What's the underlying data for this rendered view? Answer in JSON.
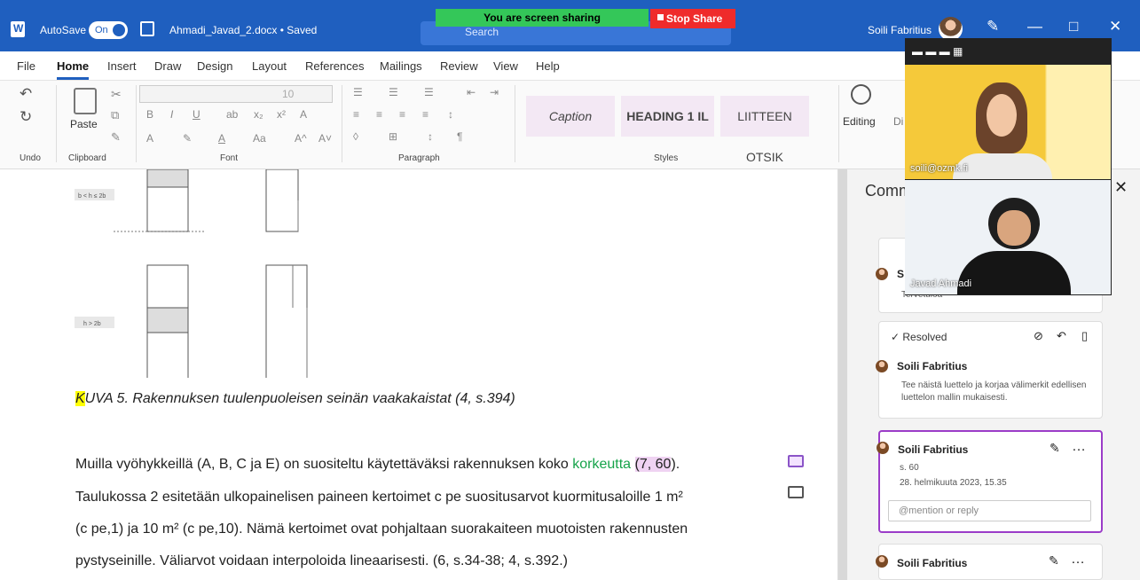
{
  "app": {
    "autosave_label": "AutoSave",
    "autosave_state": "On",
    "document_title": "Ahmadi_Javad_2.docx • Saved",
    "search_placeholder": "Search",
    "screen_sharing": "You are screen sharing",
    "stop_share": "Stop Share",
    "user_name": "Soili Fabritius"
  },
  "menu": [
    "File",
    "Home",
    "Insert",
    "Draw",
    "Design",
    "Layout",
    "References",
    "Mailings",
    "Review",
    "View",
    "Help"
  ],
  "ribbon": {
    "groups": [
      "Undo",
      "Clipboard",
      "Font",
      "Paragraph",
      "Styles",
      "Editing"
    ],
    "paste": "Paste",
    "font_size": "10",
    "styles": [
      "Caption",
      "HEADING 1 IL",
      "LIITTEEN OTSIK"
    ],
    "editing": "Editing",
    "partial_label": "Di"
  },
  "document": {
    "figure_label_1": "b < h ≤ 2b",
    "figure_label_2": "h > 2b",
    "caption_first": "K",
    "caption_rest": "UVA 5. Rakennuksen tuulenpuoleisen seinän vaakakaistat (4, s.394)",
    "line1_pre": "Muilla vyöhykkeillä (A, B, C ja E) on suositeltu käytettäväksi rakennuksen koko ",
    "line1_green": "korkeutta",
    "line1_hl": "(7, 60",
    "line1_end": ").",
    "line2": "Taulukossa 2 esitetään ulkopainelisen paineen kertoimet c pe suositusarvot kuormitusaloille 1 m²",
    "line3": "(c pe,1) ja 10 m² (c pe,10). Nämä kertoimet ovat pohjaltaan suorakaiteen muotoisten rakennusten",
    "line4": "pystyseinille. Väliarvot voidaan interpoloida lineaarisesti. (6, s.34-38; 4, s.392.)"
  },
  "comments": {
    "panel_title": "Comments",
    "partial_name": "S",
    "partial_text": "Tervetuloa",
    "resolved": "Resolved",
    "card1_name": "Soili Fabritius",
    "card1_text": "Tee näistä luettelo ja korjaa välimerkit edellisen luettelon mallin mukaisesti.",
    "card2_name": "Soili Fabritius",
    "card2_text": "s. 60",
    "card2_date": "28. helmikuuta 2023, 15.35",
    "reply_placeholder": "@mention or reply",
    "card3_name": "Soili Fabritius"
  },
  "video": {
    "person1": "soili@ozmk.fi",
    "person2": "Javad Ahmadi"
  }
}
